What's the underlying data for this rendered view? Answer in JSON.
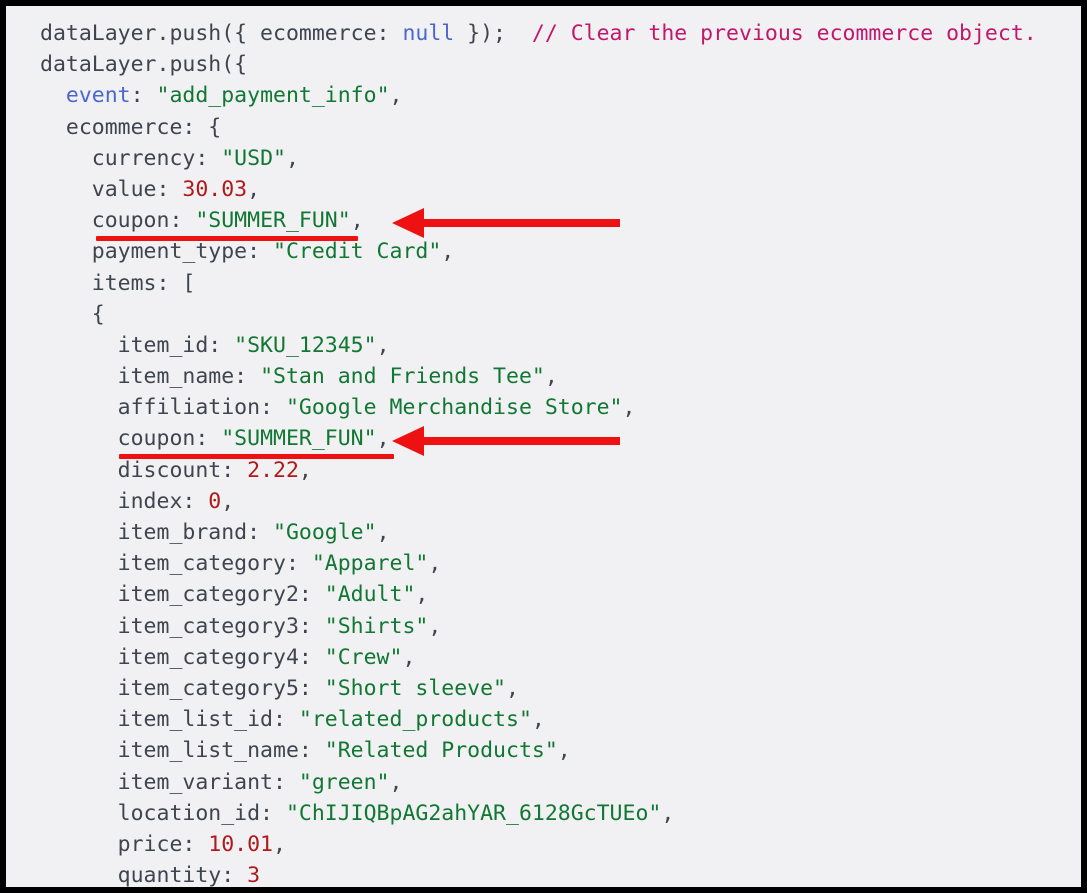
{
  "snippet": {
    "language": "javascript",
    "background_color": "#f1f1f3",
    "border_color": "#000000",
    "colors": {
      "plain": "#3f4550",
      "key": "#4a67cf",
      "string": "#117733",
      "number": "#b01919",
      "comment": "#c2176b",
      "annotation": "#ee1111"
    },
    "lines": [
      {
        "indent": "",
        "tokens": [
          {
            "type": "plain",
            "text": "dataLayer.push({ ecommerce: "
          },
          {
            "type": "null",
            "text": "null"
          },
          {
            "type": "plain",
            "text": " });  "
          },
          {
            "type": "comment",
            "text": "// Clear the previous ecommerce object."
          }
        ]
      },
      {
        "indent": "",
        "tokens": [
          {
            "type": "plain",
            "text": "dataLayer.push({"
          }
        ]
      },
      {
        "indent": "  ",
        "tokens": [
          {
            "type": "key",
            "text": "event"
          },
          {
            "type": "plain",
            "text": ": "
          },
          {
            "type": "string",
            "text": "\"add_payment_info\""
          },
          {
            "type": "plain",
            "text": ","
          }
        ]
      },
      {
        "indent": "  ",
        "tokens": [
          {
            "type": "plain",
            "text": "ecommerce: {"
          }
        ]
      },
      {
        "indent": "    ",
        "tokens": [
          {
            "type": "plain",
            "text": "currency: "
          },
          {
            "type": "string",
            "text": "\"USD\""
          },
          {
            "type": "plain",
            "text": ","
          }
        ]
      },
      {
        "indent": "    ",
        "tokens": [
          {
            "type": "plain",
            "text": "value: "
          },
          {
            "type": "num",
            "text": "30.03"
          },
          {
            "type": "plain",
            "text": ","
          }
        ]
      },
      {
        "indent": "    ",
        "tokens": [
          {
            "type": "plain",
            "text": "coupon: "
          },
          {
            "type": "string",
            "text": "\"SUMMER_FUN\""
          },
          {
            "type": "plain",
            "text": ","
          }
        ]
      },
      {
        "indent": "    ",
        "tokens": [
          {
            "type": "plain",
            "text": "payment_type: "
          },
          {
            "type": "string",
            "text": "\"Credit Card\""
          },
          {
            "type": "plain",
            "text": ","
          }
        ]
      },
      {
        "indent": "    ",
        "tokens": [
          {
            "type": "plain",
            "text": "items: ["
          }
        ]
      },
      {
        "indent": "    ",
        "tokens": [
          {
            "type": "plain",
            "text": "{"
          }
        ]
      },
      {
        "indent": "      ",
        "tokens": [
          {
            "type": "plain",
            "text": "item_id: "
          },
          {
            "type": "string",
            "text": "\"SKU_12345\""
          },
          {
            "type": "plain",
            "text": ","
          }
        ]
      },
      {
        "indent": "      ",
        "tokens": [
          {
            "type": "plain",
            "text": "item_name: "
          },
          {
            "type": "string",
            "text": "\"Stan and Friends Tee\""
          },
          {
            "type": "plain",
            "text": ","
          }
        ]
      },
      {
        "indent": "      ",
        "tokens": [
          {
            "type": "plain",
            "text": "affiliation: "
          },
          {
            "type": "string",
            "text": "\"Google Merchandise Store\""
          },
          {
            "type": "plain",
            "text": ","
          }
        ]
      },
      {
        "indent": "      ",
        "tokens": [
          {
            "type": "plain",
            "text": "coupon: "
          },
          {
            "type": "string",
            "text": "\"SUMMER_FUN\""
          },
          {
            "type": "plain",
            "text": ","
          }
        ]
      },
      {
        "indent": "      ",
        "tokens": [
          {
            "type": "plain",
            "text": "discount: "
          },
          {
            "type": "num",
            "text": "2.22"
          },
          {
            "type": "plain",
            "text": ","
          }
        ]
      },
      {
        "indent": "      ",
        "tokens": [
          {
            "type": "plain",
            "text": "index: "
          },
          {
            "type": "num",
            "text": "0"
          },
          {
            "type": "plain",
            "text": ","
          }
        ]
      },
      {
        "indent": "      ",
        "tokens": [
          {
            "type": "plain",
            "text": "item_brand: "
          },
          {
            "type": "string",
            "text": "\"Google\""
          },
          {
            "type": "plain",
            "text": ","
          }
        ]
      },
      {
        "indent": "      ",
        "tokens": [
          {
            "type": "plain",
            "text": "item_category: "
          },
          {
            "type": "string",
            "text": "\"Apparel\""
          },
          {
            "type": "plain",
            "text": ","
          }
        ]
      },
      {
        "indent": "      ",
        "tokens": [
          {
            "type": "plain",
            "text": "item_category2: "
          },
          {
            "type": "string",
            "text": "\"Adult\""
          },
          {
            "type": "plain",
            "text": ","
          }
        ]
      },
      {
        "indent": "      ",
        "tokens": [
          {
            "type": "plain",
            "text": "item_category3: "
          },
          {
            "type": "string",
            "text": "\"Shirts\""
          },
          {
            "type": "plain",
            "text": ","
          }
        ]
      },
      {
        "indent": "      ",
        "tokens": [
          {
            "type": "plain",
            "text": "item_category4: "
          },
          {
            "type": "string",
            "text": "\"Crew\""
          },
          {
            "type": "plain",
            "text": ","
          }
        ]
      },
      {
        "indent": "      ",
        "tokens": [
          {
            "type": "plain",
            "text": "item_category5: "
          },
          {
            "type": "string",
            "text": "\"Short sleeve\""
          },
          {
            "type": "plain",
            "text": ","
          }
        ]
      },
      {
        "indent": "      ",
        "tokens": [
          {
            "type": "plain",
            "text": "item_list_id: "
          },
          {
            "type": "string",
            "text": "\"related_products\""
          },
          {
            "type": "plain",
            "text": ","
          }
        ]
      },
      {
        "indent": "      ",
        "tokens": [
          {
            "type": "plain",
            "text": "item_list_name: "
          },
          {
            "type": "string",
            "text": "\"Related Products\""
          },
          {
            "type": "plain",
            "text": ","
          }
        ]
      },
      {
        "indent": "      ",
        "tokens": [
          {
            "type": "plain",
            "text": "item_variant: "
          },
          {
            "type": "string",
            "text": "\"green\""
          },
          {
            "type": "plain",
            "text": ","
          }
        ]
      },
      {
        "indent": "      ",
        "tokens": [
          {
            "type": "plain",
            "text": "location_id: "
          },
          {
            "type": "string",
            "text": "\"ChIJIQBpAG2ahYAR_6128GcTUEo\""
          },
          {
            "type": "plain",
            "text": ","
          }
        ]
      },
      {
        "indent": "      ",
        "tokens": [
          {
            "type": "plain",
            "text": "price: "
          },
          {
            "type": "num",
            "text": "10.01"
          },
          {
            "type": "plain",
            "text": ","
          }
        ]
      },
      {
        "indent": "      ",
        "tokens": [
          {
            "type": "plain",
            "text": "quantity: "
          },
          {
            "type": "num",
            "text": "3"
          }
        ]
      }
    ]
  },
  "annotations": {
    "arrows": [
      {
        "id": "arrow-coupon-1",
        "direction": "left",
        "target_line_text": "coupon: \"SUMMER_FUN\","
      },
      {
        "id": "arrow-coupon-2",
        "direction": "left",
        "target_line_text": "coupon: \"SUMMER_FUN\","
      }
    ],
    "underlines": [
      {
        "id": "underline-coupon-1",
        "target_line_text": "coupon: \"SUMMER_FUN\""
      },
      {
        "id": "underline-coupon-2",
        "target_line_text": "coupon: \"SUMMER_FUN\""
      }
    ]
  }
}
